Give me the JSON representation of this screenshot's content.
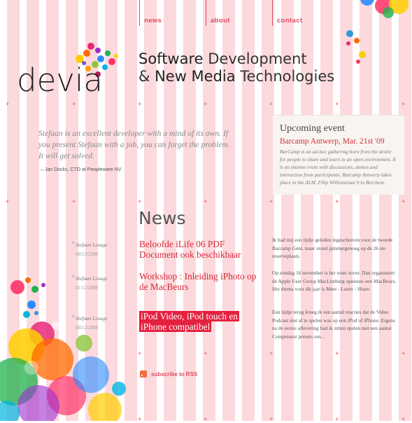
{
  "nav": {
    "items": [
      {
        "label": "news"
      },
      {
        "label": "about"
      },
      {
        "label": "contact"
      }
    ]
  },
  "logo": {
    "text": "devia"
  },
  "tagline": {
    "line1_bold": "Software",
    "line1_rest": " Development",
    "line2_amp": "& ",
    "line2_bold1": "New Media",
    "line2_rest": " Technologies"
  },
  "quote": {
    "text": "Stefaan is an excellent developer with a mind of its own. If you present Stefaan with a job, you can forget the problem. It will get solved.",
    "author": "– Jan Docks, CTO at Peopleware NV"
  },
  "event": {
    "heading": "Upcoming event",
    "title": "Barcamp Antwerp, Mar. 21st '09",
    "body": "BarCamp is an ad-hoc gathering born from the desire for people to share and learn in an open environment. It is an intense event with discussions, demos and interaction from participants. Barcamp Antwerp takes place in the ALM, Filip Williotstraat 9 in Berchem."
  },
  "news": {
    "title": "News",
    "items": [
      {
        "author": "Stefaan Lesage",
        "date": "08/12/2008",
        "title": "Beloofde iLife 06 PDF Document ook beschikbaar",
        "summary": "Ik had mij een tijdje geleden ingeschreven voor de tweede Barcamp Gent, maar stond jammergenoeg op de 26 ste reserveplaats."
      },
      {
        "author": "Stefaan Lesage",
        "date": "01/12/2008",
        "title": "Workshop : Inleiding iPhoto op de MacBeurs",
        "summary": "Op zondag 16 november is het weer zover. Dan organiseert de Apple User Group MacLimburg opnieuw een MacBeurs. Het thema voor dit jaar is Meet - Learn - Share."
      },
      {
        "author": "Stefaan Lesage",
        "date": "08/12/2008",
        "title": "iPod Video, iPod touch en iPhone compatibel",
        "summary": "Een tijdje terug kreeg ik een aantal reacties dat de Video Podcast niet af te spelen was op een iPod of iPhone. Ergens na de eerste aflevering had ik zitten spelen met een aantal Compressor presets om..."
      }
    ],
    "rss_label": "subscribe to RSS"
  },
  "icons": {
    "rss": "rss-icon",
    "marker": "plus-icon"
  },
  "colors": {
    "accent": "#e1495f",
    "stripe": "#fcd9dc",
    "highlight": "#e4213f"
  }
}
